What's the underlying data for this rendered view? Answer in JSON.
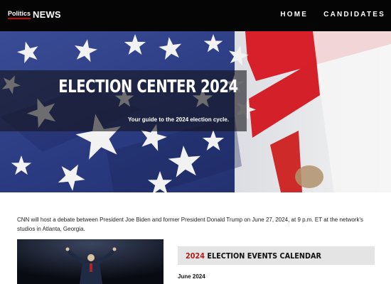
{
  "brand": {
    "small": "Politics",
    "big": "NEWS"
  },
  "nav": {
    "items": [
      {
        "label": "HOME"
      },
      {
        "label": "CANDIDATES"
      }
    ]
  },
  "hero": {
    "title": "ELECTION CENTER 2024",
    "subtitle": "Your guide to the 2024 election cycle."
  },
  "intro": "CNN will host a debate between President Joe Biden and former President Donald Trump on June 27, 2024, at 9 p.m. ET at the network's studios in Atlanta, Georgia.",
  "calendar": {
    "year": "2024",
    "title": "ELECTION EVENTS CALENDAR"
  },
  "month": "June 2024",
  "colors": {
    "topbar": "#050505",
    "accent": "#cc0000",
    "calendar_year": "#b21a1a",
    "calendar_bg": "#e4e4e4"
  },
  "icons": {
    "hero_image": "american-flag-image",
    "photo": "candidate-stage-photo"
  }
}
